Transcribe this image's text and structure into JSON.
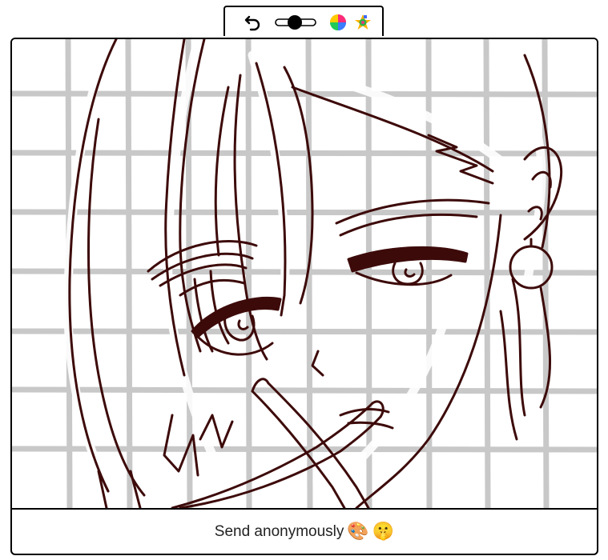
{
  "toolbar": {
    "icons": [
      "undo-icon",
      "brush-size-slider",
      "color-wheel-icon",
      "color-picker-icon"
    ],
    "brush_size": 0.5
  },
  "canvas": {
    "content": "sketch drawing",
    "line_color": "#3d0a0a",
    "grid_color": "#c8c8c8"
  },
  "footer": {
    "send_label": "Send anonymously",
    "emoji_1": "🎨",
    "emoji_2": "🤫"
  }
}
